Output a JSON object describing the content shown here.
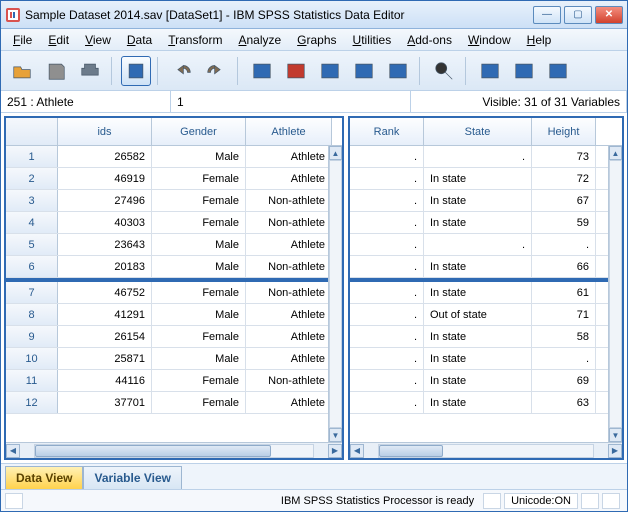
{
  "window": {
    "title": "Sample Dataset 2014.sav [DataSet1] - IBM SPSS Statistics Data Editor"
  },
  "menu": [
    "File",
    "Edit",
    "View",
    "Data",
    "Transform",
    "Analyze",
    "Graphs",
    "Utilities",
    "Add-ons",
    "Window",
    "Help"
  ],
  "info": {
    "cell_name": "251 : Athlete",
    "cell_value": "1",
    "visible": "Visible: 31 of 31 Variables"
  },
  "colsL": [
    "",
    "ids",
    "Gender",
    "Athlete"
  ],
  "colsR": [
    "Rank",
    "State",
    "Height"
  ],
  "rows": [
    {
      "n": "1",
      "ids": "26582",
      "g": "Male",
      "a": "Athlete",
      "rank": ".",
      "state": ".",
      "h": "73"
    },
    {
      "n": "2",
      "ids": "46919",
      "g": "Female",
      "a": "Athlete",
      "rank": ".",
      "state": "In state",
      "h": "72"
    },
    {
      "n": "3",
      "ids": "27496",
      "g": "Female",
      "a": "Non-athlete",
      "rank": ".",
      "state": "In state",
      "h": "67"
    },
    {
      "n": "4",
      "ids": "40303",
      "g": "Female",
      "a": "Non-athlete",
      "rank": ".",
      "state": "In state",
      "h": "59"
    },
    {
      "n": "5",
      "ids": "23643",
      "g": "Male",
      "a": "Athlete",
      "rank": ".",
      "state": ".",
      "h": "."
    },
    {
      "n": "6",
      "ids": "20183",
      "g": "Male",
      "a": "Non-athlete",
      "rank": ".",
      "state": "In state",
      "h": "66"
    },
    {
      "n": "7",
      "ids": "46752",
      "g": "Female",
      "a": "Non-athlete",
      "rank": ".",
      "state": "In state",
      "h": "61"
    },
    {
      "n": "8",
      "ids": "41291",
      "g": "Male",
      "a": "Athlete",
      "rank": ".",
      "state": "Out of state",
      "h": "71"
    },
    {
      "n": "9",
      "ids": "26154",
      "g": "Female",
      "a": "Athlete",
      "rank": ".",
      "state": "In state",
      "h": "58"
    },
    {
      "n": "10",
      "ids": "25871",
      "g": "Male",
      "a": "Athlete",
      "rank": ".",
      "state": "In state",
      "h": "."
    },
    {
      "n": "11",
      "ids": "44116",
      "g": "Female",
      "a": "Non-athlete",
      "rank": ".",
      "state": "In state",
      "h": "69"
    },
    {
      "n": "12",
      "ids": "37701",
      "g": "Female",
      "a": "Athlete",
      "rank": ".",
      "state": "In state",
      "h": "63"
    }
  ],
  "split_after": 6,
  "tabs": {
    "data": "Data View",
    "var": "Variable View"
  },
  "status": {
    "processor": "IBM SPSS Statistics Processor is ready",
    "unicode": "Unicode:ON"
  },
  "icons": {
    "open": "#e7a138",
    "save": "#8f8f8f",
    "print": "#6c7b8b",
    "recall": "#2f6ab3",
    "undo": "#7e6b53",
    "redo": "#7e6b53",
    "goto": "#2f6ab3",
    "vars": "#c23a2e",
    "split": "#2f6ab3",
    "weight": "#2f6ab3",
    "select": "#2f6ab3",
    "find": "#333",
    "insert": "#2f6ab3",
    "value": "#2f6ab3",
    "custom": "#2f6ab3"
  }
}
